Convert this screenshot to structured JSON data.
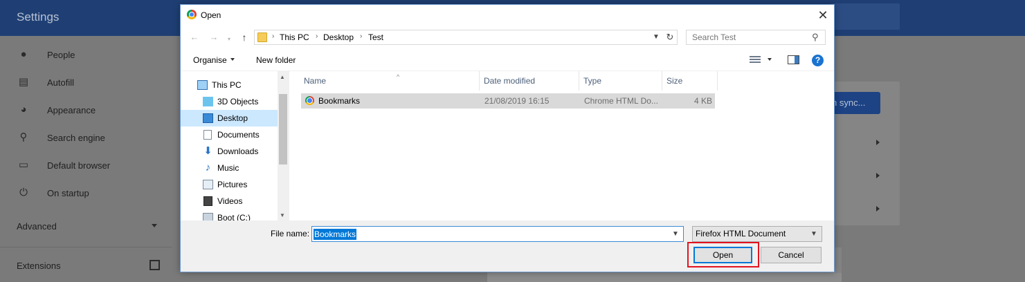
{
  "background": {
    "title": "Settings",
    "nav_items": [
      {
        "icon": "person-icon",
        "label": "People"
      },
      {
        "icon": "clipboard-icon",
        "label": "Autofill"
      },
      {
        "icon": "palette-icon",
        "label": "Appearance"
      },
      {
        "icon": "search-icon",
        "label": "Search engine"
      },
      {
        "icon": "browser-window-icon",
        "label": "Default browser"
      },
      {
        "icon": "power-icon",
        "label": "On startup"
      }
    ],
    "advanced_label": "Advanced",
    "extensions_label": "Extensions",
    "sync_button_label": "n sync..."
  },
  "dialog": {
    "title": "Open",
    "breadcrumb": [
      "This PC",
      "Desktop",
      "Test"
    ],
    "search_placeholder": "Search Test",
    "toolbar": {
      "organise_label": "Organise",
      "new_folder_label": "New folder"
    },
    "tree": [
      {
        "icon": "monitor-icon",
        "label": "This PC",
        "selected": false
      },
      {
        "icon": "3d-objects-icon",
        "label": "3D Objects",
        "selected": false
      },
      {
        "icon": "desktop-icon",
        "label": "Desktop",
        "selected": true
      },
      {
        "icon": "documents-icon",
        "label": "Documents",
        "selected": false
      },
      {
        "icon": "downloads-icon",
        "label": "Downloads",
        "selected": false
      },
      {
        "icon": "music-icon",
        "label": "Music",
        "selected": false
      },
      {
        "icon": "pictures-icon",
        "label": "Pictures",
        "selected": false
      },
      {
        "icon": "videos-icon",
        "label": "Videos",
        "selected": false
      },
      {
        "icon": "drive-icon",
        "label": "Boot (C:)",
        "selected": false
      }
    ],
    "columns": [
      "Name",
      "Date modified",
      "Type",
      "Size"
    ],
    "files": [
      {
        "name": "Bookmarks",
        "date_modified": "21/08/2019 16:15",
        "type": "Chrome HTML Do...",
        "size": "4 KB"
      }
    ],
    "file_name_label": "File name:",
    "file_name_value": "Bookmarks",
    "file_type_value": "Firefox HTML Document",
    "open_label": "Open",
    "cancel_label": "Cancel",
    "help_glyph": "?"
  },
  "colors": {
    "highlight": "#e3121f",
    "selection": "#0078d7",
    "header_bg": "#1f3f74"
  }
}
